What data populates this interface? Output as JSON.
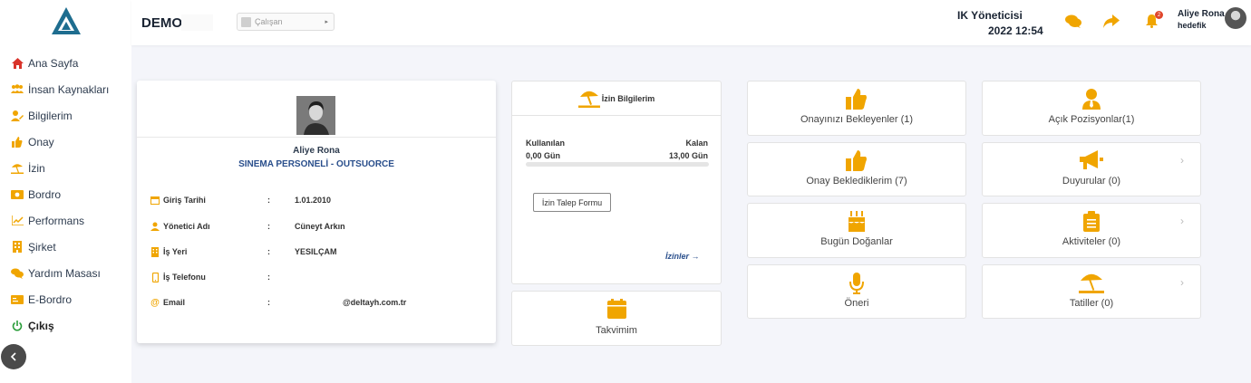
{
  "header": {
    "brand": "DEMO",
    "role_placeholder": "Çalışan",
    "admin_title": "IK Yöneticisi",
    "admin_time": "2022 12:54",
    "notification_count": "2",
    "user_name": "Aliye Rona",
    "user_sub": "hedefik"
  },
  "sidebar": {
    "items": [
      {
        "label": "Ana Sayfa",
        "icon": "home-icon"
      },
      {
        "label": "İnsan Kaynakları",
        "icon": "users-icon"
      },
      {
        "label": "Bilgilerim",
        "icon": "user-edit-icon"
      },
      {
        "label": "Onay",
        "icon": "thumbs-up-icon"
      },
      {
        "label": "İzin",
        "icon": "umbrella-beach-icon"
      },
      {
        "label": "Bordro",
        "icon": "money-icon"
      },
      {
        "label": "Performans",
        "icon": "chart-line-icon"
      },
      {
        "label": "Şirket",
        "icon": "building-icon"
      },
      {
        "label": "Yardım Masası",
        "icon": "comments-icon"
      },
      {
        "label": "E-Bordro",
        "icon": "id-card-icon"
      },
      {
        "label": "Çıkış",
        "icon": "power-icon"
      }
    ]
  },
  "profile": {
    "name": "Aliye Rona",
    "title": "SINEMA PERSONELİ - OUTSUORCE",
    "rows": [
      {
        "label": "Giriş Tarihi",
        "sep": ":",
        "value": "1.01.2010"
      },
      {
        "label": "Yönetici Adı",
        "sep": ":",
        "value": "Cüneyt Arkın"
      },
      {
        "label": "İş Yeri",
        "sep": ":",
        "value": "YESILÇAM"
      },
      {
        "label": "İş Telefonu",
        "sep": ":",
        "value": ""
      },
      {
        "label": "Email",
        "sep": ":",
        "value": "@deltayh.com.tr"
      }
    ]
  },
  "izin": {
    "title": "İzin Bilgilerim",
    "used_label": "Kullanılan",
    "used_value": "0,00 Gün",
    "remaining_label": "Kalan",
    "remaining_value": "13,00 Gün",
    "used_fraction": 0,
    "form_button": "İzin Talep Formu",
    "link": "İzinler"
  },
  "takvim": {
    "label": "Takvimim"
  },
  "tiles": {
    "onayinizi": "Onayınızı Bekleyenler (1)",
    "onay_bekle": "Onay Beklediklerim (7)",
    "dogan": "Bugün Doğanlar",
    "oneri": "Öneri",
    "pozisyon": "Açık Pozisyonlar(1)",
    "duyuru": "Duyurular (0)",
    "aktivite": "Aktiviteler (0)",
    "tatil": "Tatiller (0)"
  },
  "colors": {
    "accent": "#f0a500",
    "nav_blue": "#2a4f8c",
    "logo_blue": "#1e6d8f"
  }
}
